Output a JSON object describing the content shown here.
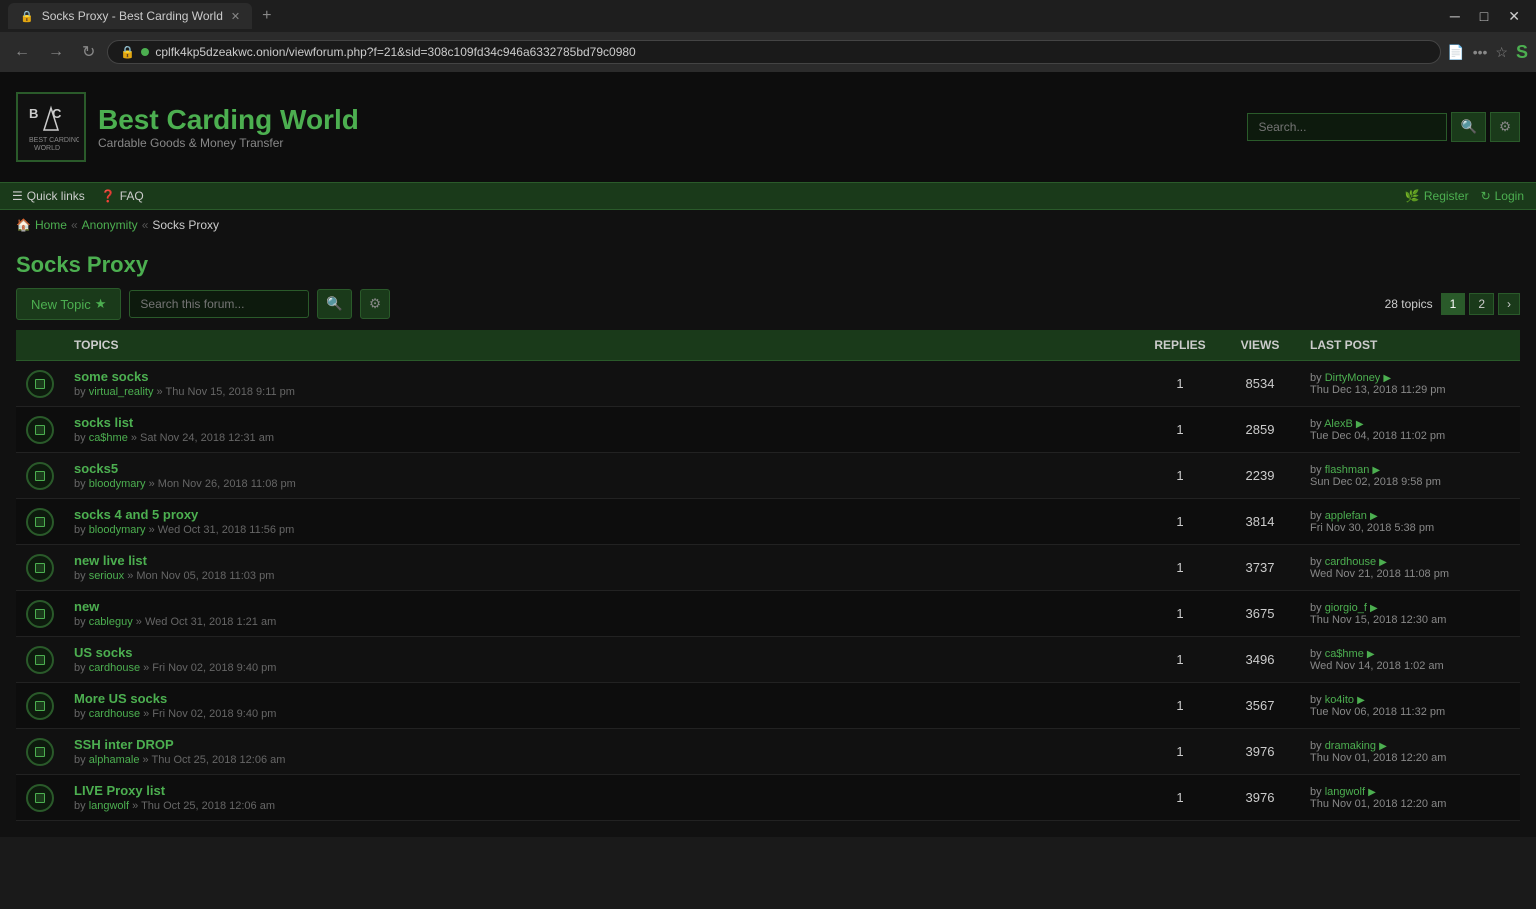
{
  "browser": {
    "tab_title": "Socks Proxy - Best Carding World",
    "url": "cplfk4kp5dzeakwc.onion/viewforum.php?f=21&sid=308c109fd34c946a6332785bd79c0980",
    "new_tab_label": "+"
  },
  "site": {
    "title": "Best Carding World",
    "subtitle": "Cardable Goods & Money Transfer",
    "search_placeholder": "Search..."
  },
  "navbar": {
    "quick_links": "Quick links",
    "faq": "FAQ",
    "register": "Register",
    "login": "Login"
  },
  "breadcrumb": {
    "home": "Home",
    "anonymity": "Anonymity",
    "current": "Socks Proxy"
  },
  "forum": {
    "title": "Socks Proxy",
    "new_topic_label": "New Topic",
    "search_placeholder": "Search this forum...",
    "topics_count": "28 topics",
    "headers": {
      "topics": "TOPICS",
      "replies": "REPLIES",
      "views": "VIEWS",
      "last_post": "LAST POST"
    },
    "pagination": [
      {
        "label": "1",
        "active": true
      },
      {
        "label": "2",
        "active": false
      }
    ],
    "topics": [
      {
        "title": "some socks",
        "author": "virtual_reality",
        "date": "Thu Nov 15, 2018 9:11 pm",
        "replies": "1",
        "views": "8534",
        "last_by": "DirtyMoney",
        "last_date": "Thu Dec 13, 2018 11:29 pm"
      },
      {
        "title": "socks list",
        "author": "ca$hme",
        "date": "Sat Nov 24, 2018 12:31 am",
        "replies": "1",
        "views": "2859",
        "last_by": "AlexB",
        "last_date": "Tue Dec 04, 2018 11:02 pm"
      },
      {
        "title": "socks5",
        "author": "bloodymary",
        "date": "Mon Nov 26, 2018 11:08 pm",
        "replies": "1",
        "views": "2239",
        "last_by": "flashman",
        "last_date": "Sun Dec 02, 2018 9:58 pm"
      },
      {
        "title": "socks 4 and 5 proxy",
        "author": "bloodymary",
        "date": "Wed Oct 31, 2018 11:56 pm",
        "replies": "1",
        "views": "3814",
        "last_by": "applefan",
        "last_date": "Fri Nov 30, 2018 5:38 pm"
      },
      {
        "title": "new live list",
        "author": "serioux",
        "date": "Mon Nov 05, 2018 11:03 pm",
        "replies": "1",
        "views": "3737",
        "last_by": "cardhouse",
        "last_date": "Wed Nov 21, 2018 11:08 pm"
      },
      {
        "title": "new",
        "author": "cableguy",
        "date": "Wed Oct 31, 2018 1:21 am",
        "replies": "1",
        "views": "3675",
        "last_by": "giorgio_f",
        "last_date": "Thu Nov 15, 2018 12:30 am"
      },
      {
        "title": "US socks",
        "author": "cardhouse",
        "date": "Fri Nov 02, 2018 9:40 pm",
        "replies": "1",
        "views": "3496",
        "last_by": "ca$hme",
        "last_date": "Wed Nov 14, 2018 1:02 am"
      },
      {
        "title": "More US socks",
        "author": "cardhouse",
        "date": "Fri Nov 02, 2018 9:40 pm",
        "replies": "1",
        "views": "3567",
        "last_by": "ko4ito",
        "last_date": "Tue Nov 06, 2018 11:32 pm"
      },
      {
        "title": "SSH inter DROP",
        "author": "alphamale",
        "date": "Thu Oct 25, 2018 12:06 am",
        "replies": "1",
        "views": "3976",
        "last_by": "dramaking",
        "last_date": "Thu Nov 01, 2018 12:20 am"
      },
      {
        "title": "LIVE Proxy list",
        "author": "langwolf",
        "date": "Thu Oct 25, 2018 12:06 am",
        "replies": "1",
        "views": "3976",
        "last_by": "langwolf",
        "last_date": "Thu Nov 01, 2018 12:20 am"
      }
    ]
  }
}
